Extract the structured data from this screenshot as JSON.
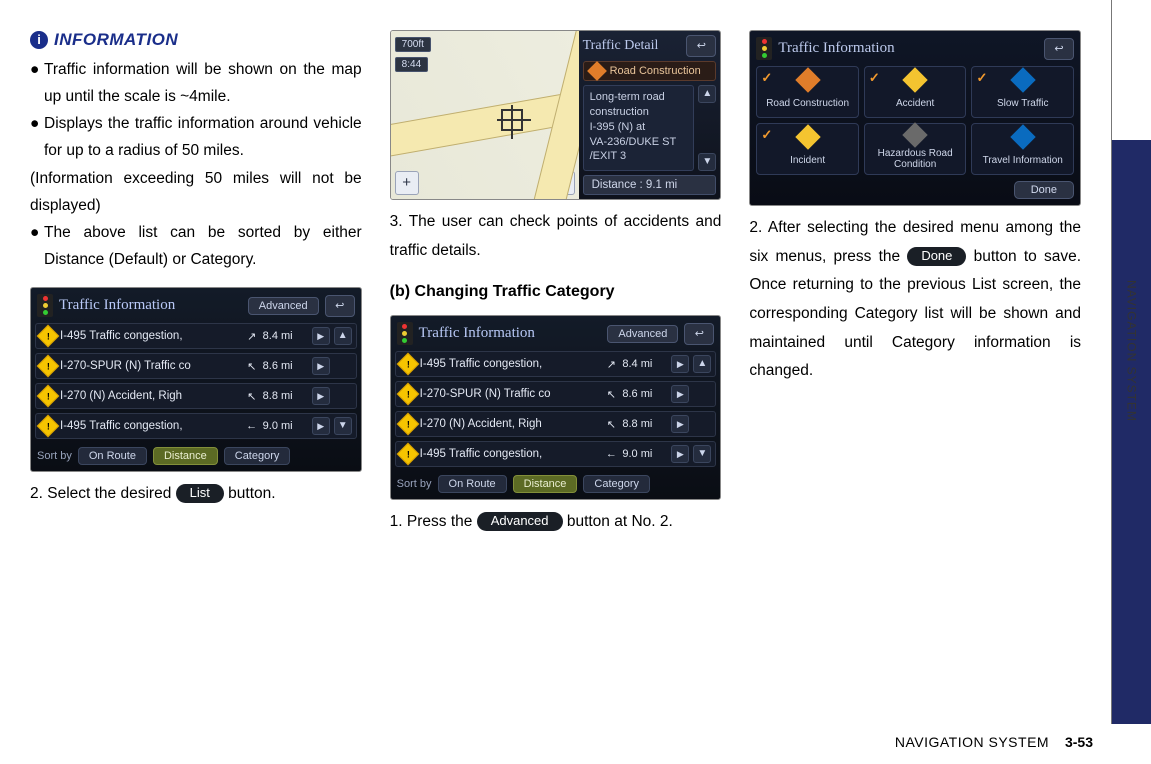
{
  "info": {
    "heading": "INFORMATION",
    "bullets": [
      "Traffic information will be shown on the map up until the scale is ~4mile.",
      "Displays the traffic information around vehicle for up to a radius of 50 miles."
    ],
    "note": "(Information exceeding 50 miles will not be displayed)",
    "bullet3": "The above list can be sorted by either Distance (Default) or Category."
  },
  "col1": {
    "step2_prefix": "2. Select the desired ",
    "step2_btn": "List",
    "step2_suffix": " button."
  },
  "col2": {
    "step3": "3. The user can check points of accidents and traffic details.",
    "subheading": "(b) Changing Traffic Category",
    "step1_prefix": "1. Press the ",
    "step1_btn": "Advanced",
    "step1_suffix": " button at No. 2."
  },
  "col3": {
    "step2_prefix": "2. After selecting the desired menu among the six menus, press the ",
    "step2_btn": "Done",
    "step2_suffix": " button to save. Once returning to the previous List screen, the corresponding Category list will be shown and maintained until Category information is changed."
  },
  "ti_list": {
    "title": "Traffic Information",
    "advanced": "Advanced",
    "rows": [
      {
        "label": "I-495 Traffic congestion,",
        "dir": "↗",
        "dist": "8.4 mi"
      },
      {
        "label": "I-270-SPUR (N) Traffic co",
        "dir": "↖",
        "dist": "8.6 mi"
      },
      {
        "label": "I-270 (N) Accident, Righ",
        "dir": "↖",
        "dist": "8.8 mi"
      },
      {
        "label": "I-495 Traffic congestion,",
        "dir": "←",
        "dist": "9.0 mi"
      }
    ],
    "sort_label": "Sort by",
    "sort_opts": [
      "On Route",
      "Distance",
      "Category"
    ]
  },
  "map_detail": {
    "scale": "700ft",
    "time": "8:44",
    "title": "Traffic Detail",
    "banner": "Road Construction",
    "body": "Long-term road construction\nI-395 (N)  at\nVA-236/DUKE ST\n/EXIT 3",
    "distance": "Distance : 9.1 mi"
  },
  "cat_screen": {
    "title": "Traffic Information",
    "tiles": [
      {
        "label": "Road Construction",
        "color": "orange",
        "checked": true
      },
      {
        "label": "Accident",
        "color": "yellow",
        "checked": true
      },
      {
        "label": "Slow Traffic",
        "color": "blue",
        "checked": true
      },
      {
        "label": "Incident",
        "color": "yellow",
        "checked": true
      },
      {
        "label": "Hazardous Road Condition",
        "color": "gray",
        "checked": false
      },
      {
        "label": "Travel Information",
        "color": "blue",
        "checked": false
      }
    ],
    "done": "Done"
  },
  "side_tab": "NAVIGATION SYSTEM",
  "footer": {
    "section": "NAVIGATION SYSTEM",
    "page": "3-53"
  }
}
